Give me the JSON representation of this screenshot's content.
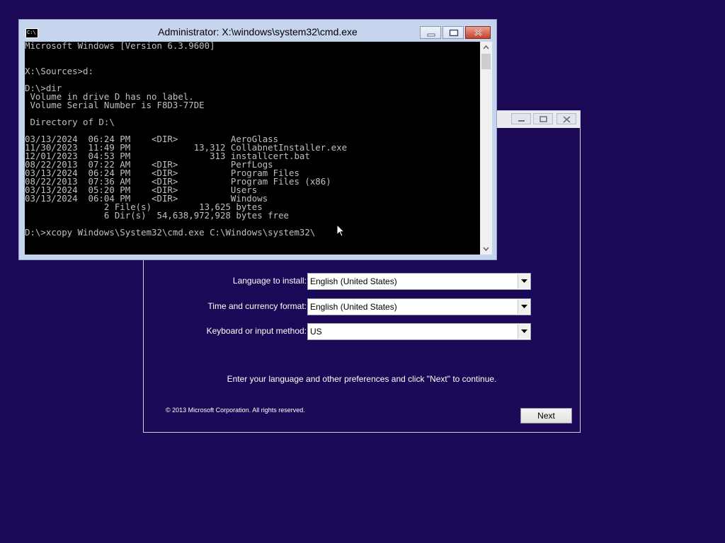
{
  "cmd_window": {
    "title": "Administrator: X:\\windows\\system32\\cmd.exe",
    "app_icon_text": "C:\\",
    "output_lines": [
      "Microsoft Windows [Version 6.3.9600]",
      "",
      "",
      "X:\\Sources>d:",
      "",
      "D:\\>dir",
      " Volume in drive D has no label.",
      " Volume Serial Number is F8D3-77DE",
      "",
      " Directory of D:\\",
      "",
      "03/13/2024  06:24 PM    <DIR>          AeroGlass",
      "11/30/2023  11:49 PM            13,312 CollabnetInstaller.exe",
      "12/01/2023  04:53 PM               313 installcert.bat",
      "08/22/2013  07:22 AM    <DIR>          PerfLogs",
      "03/13/2024  06:24 PM    <DIR>          Program Files",
      "08/22/2013  07:36 AM    <DIR>          Program Files (x86)",
      "03/13/2024  05:20 PM    <DIR>          Users",
      "03/13/2024  06:04 PM    <DIR>          Windows",
      "               2 File(s)         13,625 bytes",
      "               6 Dir(s)  54,638,972,928 bytes free",
      "",
      "D:\\>xcopy Windows\\System32\\cmd.exe C:\\Windows\\system32\\"
    ]
  },
  "setup_window": {
    "fields": [
      {
        "label": "Language to install:",
        "value": "English (United States)"
      },
      {
        "label": "Time and currency format:",
        "value": "English (United States)"
      },
      {
        "label": "Keyboard or input method:",
        "value": "US"
      }
    ],
    "instructions": "Enter your language and other preferences and click \"Next\" to continue.",
    "copyright": "© 2013 Microsoft Corporation. All rights reserved.",
    "next_label": "Next"
  },
  "colors": {
    "desktop_background": "#1b0856",
    "console_background": "#000000",
    "console_text": "#c0c0c0",
    "close_button": "#c4432c"
  },
  "icons": {
    "window_minimize": "minimize-icon",
    "window_maximize": "maximize-icon",
    "window_close": "close-icon",
    "dropdown": "chevron-down-icon",
    "cursor": "mouse-pointer-icon"
  }
}
